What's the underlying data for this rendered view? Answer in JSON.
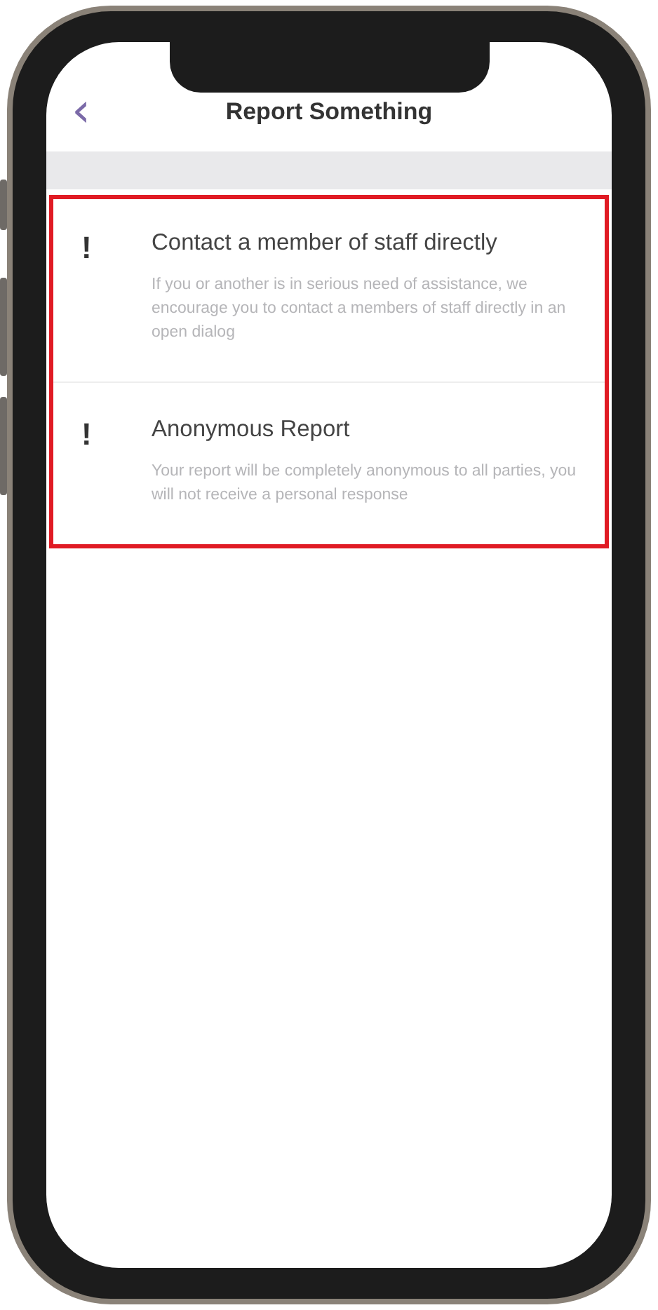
{
  "header": {
    "back_icon": "‹",
    "title": "Report Something"
  },
  "options": [
    {
      "icon": "!",
      "title": "Contact a member of staff directly",
      "description": "If you or another is in serious need of assistance, we encourage you to contact a members of staff directly in an open dialog"
    },
    {
      "icon": "!",
      "title": "Anonymous Report",
      "description": "Your report will be completely anonymous to all parties, you will not receive a personal response"
    }
  ]
}
